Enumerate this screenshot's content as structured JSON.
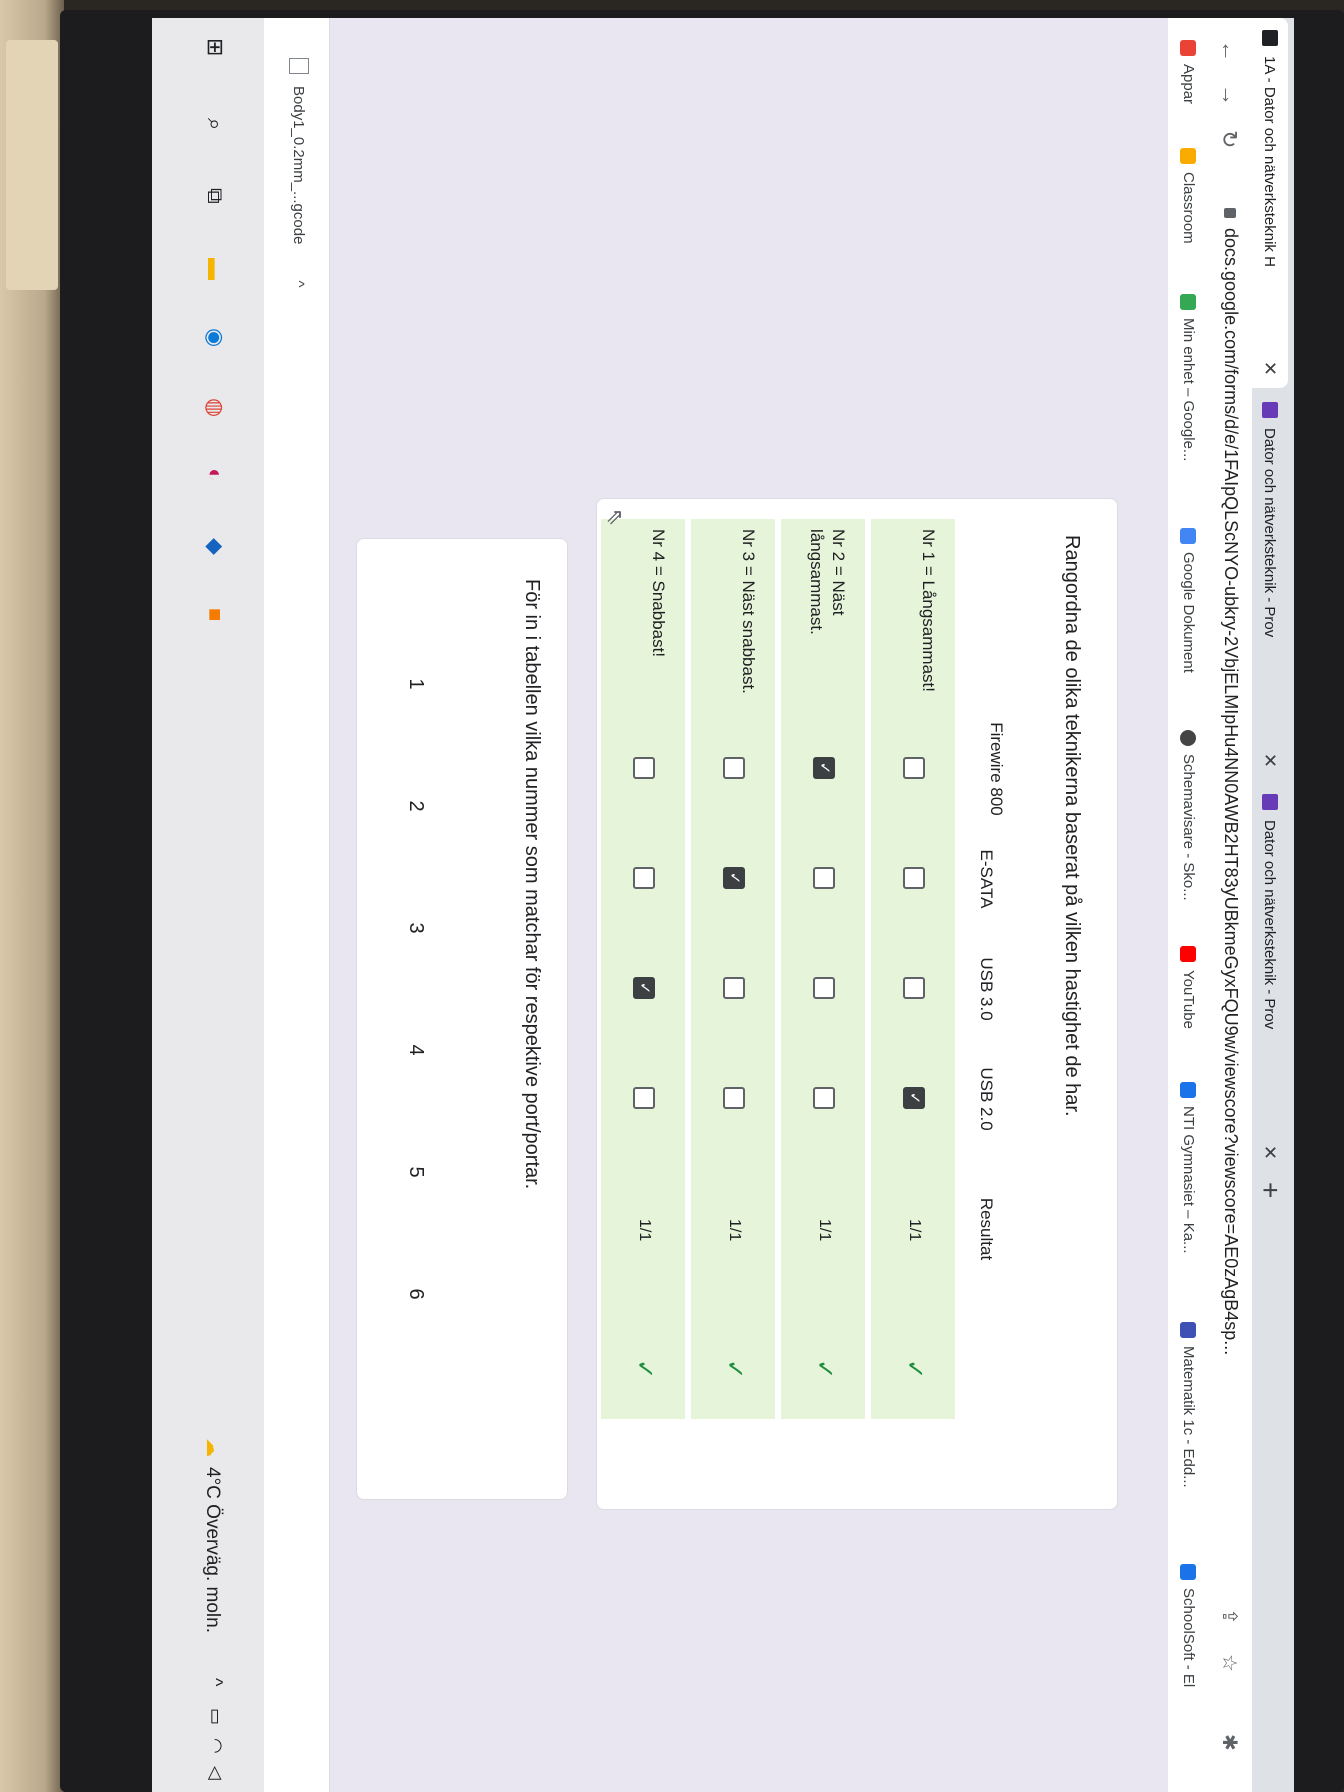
{
  "browser": {
    "tabs": [
      {
        "title": "1A - Dator och nätverksteknik H"
      },
      {
        "title": "Dator och nätverksteknik - Prov"
      },
      {
        "title": "Dator och nätverksteknik - Prov"
      }
    ],
    "new_tab": "+",
    "url": "docs.google.com/forms/d/e/1FAIpQLScNYO-ubkry-2VbjELMIpHu4NN0AWB2HT83yUBkmeGyxFQU9w/viewscore?viewscore=AE0zAgB4sp...",
    "bookmarks": [
      {
        "label": "Appar",
        "icon": "apps-grid-icon",
        "color": "#ea4335"
      },
      {
        "label": "Classroom",
        "icon": "classroom-icon",
        "color": "#f9ab00"
      },
      {
        "label": "Min enhet – Google...",
        "icon": "drive-icon",
        "color": "#34a853"
      },
      {
        "label": "Google Dokument",
        "icon": "docs-icon",
        "color": "#4285f4"
      },
      {
        "label": "Schemavisare - Sko...",
        "icon": "globe-icon",
        "color": "#444444"
      },
      {
        "label": "YouTube",
        "icon": "youtube-icon",
        "color": "#ff0000"
      },
      {
        "label": "NTI Gymnasiet – Ka...",
        "icon": "calendar-icon",
        "color": "#1a73e8"
      },
      {
        "label": "Matematik 1c - Edd...",
        "icon": "flag-icon",
        "color": "#3f51b5"
      },
      {
        "label": "SchoolSoft - El",
        "icon": "schoolsoft-icon",
        "color": "#1a73e8"
      }
    ]
  },
  "question1": {
    "title": "Rangordna de olika teknikerna baserat på vilken hastighet de har.",
    "columns": [
      "Firewire 800",
      "E-SATA",
      "USB 3.0",
      "USB 2.0",
      "Resultat"
    ],
    "rows": [
      {
        "label": "Nr 1 = Långsammast!",
        "checked": [
          false,
          false,
          false,
          true
        ],
        "score": "1/1"
      },
      {
        "label": "Nr 2 = Näst långsammast.",
        "checked": [
          true,
          false,
          false,
          false
        ],
        "score": "1/1"
      },
      {
        "label": "Nr 3 = Näst snabbast.",
        "checked": [
          false,
          true,
          false,
          false
        ],
        "score": "1/1"
      },
      {
        "label": "Nr 4 = Snabbast!",
        "checked": [
          false,
          false,
          true,
          false
        ],
        "score": "1/1"
      }
    ]
  },
  "question2": {
    "title": "För in i tabellen vilka nummer som matchar för respektive port/portar.",
    "scale": [
      "1",
      "2",
      "3",
      "4",
      "5",
      "6"
    ]
  },
  "download_bar": {
    "file": "Body1_0.2mm_...gcode",
    "chevron": "^"
  },
  "taskbar": {
    "weather": "4°C Överväg. moln."
  }
}
